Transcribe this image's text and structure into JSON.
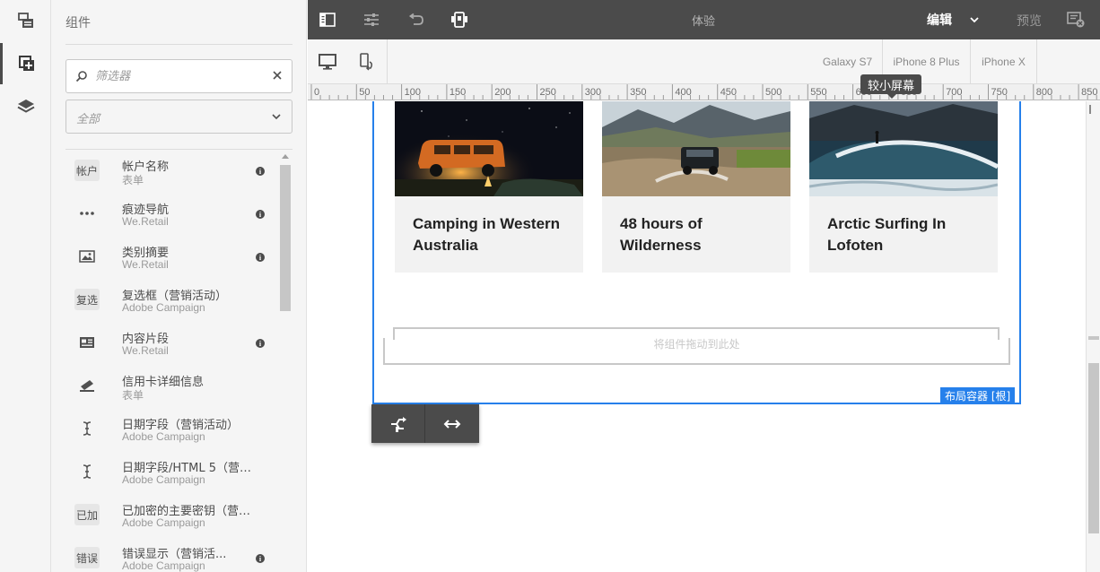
{
  "rail": {
    "items": [
      {
        "icon": "page-tree-icon"
      },
      {
        "icon": "components-icon",
        "active": true
      },
      {
        "icon": "layers-icon"
      }
    ]
  },
  "panel": {
    "title": "组件",
    "search_placeholder": "筛选器",
    "group_select": "全部",
    "components": [
      {
        "badge": "帐户",
        "name": "帐户名称",
        "group": "表单",
        "info": true
      },
      {
        "icon": "ellipsis-icon",
        "name": "痕迹导航",
        "group": "We.Retail",
        "info": true
      },
      {
        "icon": "image-icon",
        "name": "类别摘要",
        "group": "We.Retail",
        "info": true
      },
      {
        "badge": "复选",
        "name": "复选框（营销活动）",
        "group": "Adobe Campaign",
        "info": false
      },
      {
        "icon": "content-fragment-icon",
        "name": "内容片段",
        "group": "We.Retail",
        "info": true
      },
      {
        "icon": "credit-card-icon",
        "name": "信用卡详细信息",
        "group": "表单",
        "info": false
      },
      {
        "icon": "text-cursor-icon",
        "name": "日期字段（营销活动）",
        "group": "Adobe Campaign",
        "info": false
      },
      {
        "icon": "text-cursor-icon",
        "name": "日期字段/HTML 5（营销...",
        "group": "Adobe Campaign",
        "info": false
      },
      {
        "badge": "已加",
        "name": "已加密的主要密钥（营销...",
        "group": "Adobe Campaign",
        "info": false
      },
      {
        "badge": "错误",
        "name": "错误显示（营销活...",
        "group": "Adobe Campaign",
        "info": true
      }
    ]
  },
  "topbar": {
    "title": "体验",
    "mode": "编辑",
    "preview": "预览"
  },
  "emulator": {
    "devices": [
      "Galaxy S7",
      "iPhone 8 Plus",
      "iPhone X"
    ],
    "tooltip": "较小屏幕",
    "ruler_ticks": [
      "0",
      "50",
      "100",
      "150",
      "200",
      "250",
      "300",
      "350",
      "400",
      "450",
      "500",
      "550",
      "600",
      "650",
      "700",
      "750",
      "800",
      "850"
    ]
  },
  "canvas": {
    "cards": [
      {
        "title": "Camping in Western Australia"
      },
      {
        "title": "48 hours of Wilderness"
      },
      {
        "title": "Arctic Surfing In Lofoten"
      }
    ],
    "drop_text": "将组件拖动到此处",
    "container_label": "布局容器 [根]"
  },
  "colors": {
    "toolbar": "#4b4b4b",
    "accent_blue": "#2680eb",
    "panel_bg": "#f5f5f5"
  }
}
